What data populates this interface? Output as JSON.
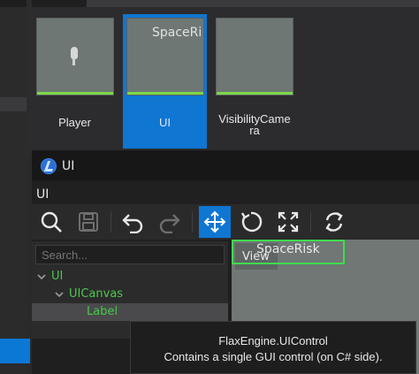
{
  "content_browser": {
    "assets": [
      {
        "label": "Player",
        "selected": false,
        "thumb_icon": "player-shape"
      },
      {
        "label": "UI",
        "selected": true,
        "thumb_text": "SpaceRi"
      },
      {
        "label": "VisibilityCamera",
        "label_line1": "VisibilityCame",
        "label_line2": "ra",
        "selected": false
      }
    ]
  },
  "ui_window": {
    "title": "UI",
    "menu_label": "UI",
    "toolbar": [
      "search-icon",
      "save-icon",
      "undo-icon",
      "redo-icon",
      "move-icon",
      "rotate-icon",
      "scale-icon",
      "refresh-icon"
    ]
  },
  "hierarchy": {
    "search_placeholder": "Search...",
    "items": [
      {
        "label": "UI",
        "level": 0,
        "expanded": true
      },
      {
        "label": "UICanvas",
        "level": 1,
        "expanded": true
      },
      {
        "label": "Label",
        "level": 2,
        "selected": true
      }
    ]
  },
  "viewport": {
    "view_tab": "View",
    "label_text": "SpaceRisk"
  },
  "tooltip": {
    "line1": "FlaxEngine.UIControl",
    "line2": "Contains a single GUI control (on C# side)."
  },
  "colors": {
    "accent": "#0f76d2",
    "tree_text": "#49c94a",
    "selection_outline": "#3fdc4f"
  }
}
